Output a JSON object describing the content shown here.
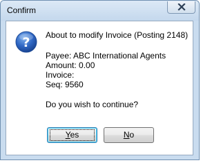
{
  "window": {
    "title": "Confirm"
  },
  "message": {
    "heading": "About to modify Invoice (Posting 2148)",
    "payee": "Payee: ABC International Agents",
    "amount": "Amount: 0.00",
    "invoice": "Invoice:",
    "seq": "Seq: 9560",
    "question": "Do you wish to continue?"
  },
  "buttons": {
    "yes_mnemonic": "Y",
    "yes_rest": "es",
    "no_mnemonic": "N",
    "no_rest": "o"
  },
  "icons": {
    "close": "close-icon",
    "dialog": "question-icon"
  },
  "colors": {
    "icon_blue": "#2a5fb0",
    "frame": "#c9dcef"
  }
}
